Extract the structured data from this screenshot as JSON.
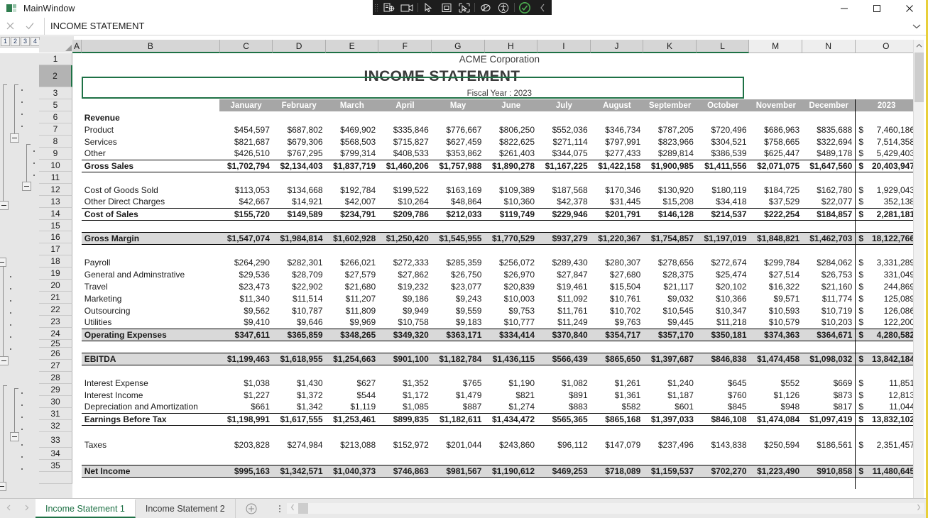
{
  "window": {
    "title": "MainWindow",
    "minimize_label": "Minimize",
    "maximize_label": "Maximize",
    "close_label": "Close"
  },
  "inspector_toolbar": {
    "buttons": [
      "inspect-element-icon",
      "record-video-icon",
      "pointer-select-icon",
      "bounding-box-icon",
      "region-select-icon",
      "highlight-toggle-icon",
      "accessibility-icon",
      "validate-check-icon",
      "collapse-chevron-icon"
    ]
  },
  "formula_bar": {
    "cancel_label": "✕",
    "accept_label": "✓",
    "value": "INCOME STATEMENT",
    "expand_label": "⌄"
  },
  "outline": {
    "levels": [
      "1",
      "2",
      "3",
      "4"
    ]
  },
  "columns": [
    "A",
    "B",
    "C",
    "D",
    "E",
    "F",
    "G",
    "H",
    "I",
    "J",
    "K",
    "L",
    "M",
    "N",
    "O"
  ],
  "rows": [
    "1",
    "2",
    "3",
    "5",
    "6",
    "7",
    "8",
    "9",
    "10",
    "11",
    "12",
    "13",
    "14",
    "15",
    "16",
    "17",
    "18",
    "19",
    "20",
    "21",
    "22",
    "23",
    "24",
    "25",
    "26",
    "27",
    "28",
    "29",
    "30",
    "31",
    "32",
    "33",
    "34",
    "35"
  ],
  "active_row": "2",
  "sheet": {
    "company": "ACME Corporation",
    "title": "INCOME STATEMENT",
    "fiscal_year": "Fiscal Year : 2023",
    "period_headers": [
      "January",
      "February",
      "March",
      "April",
      "May",
      "June",
      "July",
      "August",
      "September",
      "October",
      "November",
      "December",
      "2023"
    ],
    "sections": {
      "revenue_label": "Revenue",
      "gross_sales_label": "Gross Sales",
      "cost_of_sales_label": "Cost of Sales",
      "gross_margin_label": "Gross Margin",
      "operating_expenses_label": "Operating Expenses",
      "ebitda_label": "EBITDA",
      "earnings_before_tax_label": "Earnings Before Tax",
      "net_income_label": "Net Income"
    },
    "rows_data": [
      {
        "row": "6",
        "label": "Revenue",
        "style": "section",
        "values": []
      },
      {
        "row": "7",
        "label": "Product",
        "style": "item",
        "values": [
          "$454,597",
          "$687,802",
          "$469,902",
          "$335,846",
          "$776,667",
          "$806,250",
          "$552,036",
          "$346,734",
          "$787,205",
          "$720,496",
          "$686,963",
          "$835,688"
        ],
        "total": "7,460,186"
      },
      {
        "row": "8",
        "label": "Services",
        "style": "item",
        "values": [
          "$821,687",
          "$679,306",
          "$568,503",
          "$715,827",
          "$627,459",
          "$822,625",
          "$271,114",
          "$797,991",
          "$823,966",
          "$304,521",
          "$758,665",
          "$322,694"
        ],
        "total": "7,514,358"
      },
      {
        "row": "9",
        "label": "Other",
        "style": "item",
        "values": [
          "$426,510",
          "$767,295",
          "$799,314",
          "$408,533",
          "$353,862",
          "$261,403",
          "$344,075",
          "$277,433",
          "$289,814",
          "$386,539",
          "$625,447",
          "$489,178"
        ],
        "total": "5,429,403"
      },
      {
        "row": "10",
        "label": "Gross Sales",
        "style": "subtotal",
        "values": [
          "$1,702,794",
          "$2,134,403",
          "$1,837,719",
          "$1,460,206",
          "$1,757,988",
          "$1,890,278",
          "$1,167,225",
          "$1,422,158",
          "$1,900,985",
          "$1,411,556",
          "$2,071,075",
          "$1,647,560"
        ],
        "total": "20,403,947"
      },
      {
        "row": "11",
        "label": "",
        "style": "blank",
        "values": []
      },
      {
        "row": "12",
        "label": "Cost of Goods Sold",
        "style": "item",
        "values": [
          "$113,053",
          "$134,668",
          "$192,784",
          "$199,522",
          "$163,169",
          "$109,389",
          "$187,568",
          "$170,346",
          "$130,920",
          "$180,119",
          "$184,725",
          "$162,780"
        ],
        "total": "1,929,043"
      },
      {
        "row": "13",
        "label": "Other Direct Charges",
        "style": "item",
        "values": [
          "$42,667",
          "$14,921",
          "$42,007",
          "$10,264",
          "$48,864",
          "$10,360",
          "$42,378",
          "$31,445",
          "$15,208",
          "$34,418",
          "$37,529",
          "$22,077"
        ],
        "total": "352,138"
      },
      {
        "row": "14",
        "label": "Cost of Sales",
        "style": "subtotal",
        "values": [
          "$155,720",
          "$149,589",
          "$234,791",
          "$209,786",
          "$212,033",
          "$119,749",
          "$229,946",
          "$201,791",
          "$146,128",
          "$214,537",
          "$222,254",
          "$184,857"
        ],
        "total": "2,281,181"
      },
      {
        "row": "15",
        "label": "",
        "style": "blank",
        "values": []
      },
      {
        "row": "16",
        "label": "Gross Margin",
        "style": "shaded-total",
        "values": [
          "$1,547,074",
          "$1,984,814",
          "$1,602,928",
          "$1,250,420",
          "$1,545,955",
          "$1,770,529",
          "$937,279",
          "$1,220,367",
          "$1,754,857",
          "$1,197,019",
          "$1,848,821",
          "$1,462,703"
        ],
        "total": "18,122,766"
      },
      {
        "row": "17",
        "label": "",
        "style": "blank",
        "values": []
      },
      {
        "row": "18",
        "label": "Payroll",
        "style": "item",
        "values": [
          "$264,290",
          "$282,301",
          "$266,021",
          "$272,333",
          "$285,359",
          "$256,072",
          "$289,430",
          "$280,307",
          "$278,656",
          "$272,674",
          "$299,784",
          "$284,062"
        ],
        "total": "3,331,289"
      },
      {
        "row": "19",
        "label": "General and Adminstrative",
        "style": "item",
        "values": [
          "$29,536",
          "$28,709",
          "$27,579",
          "$27,862",
          "$26,750",
          "$26,970",
          "$27,847",
          "$27,680",
          "$28,375",
          "$25,474",
          "$27,514",
          "$26,753"
        ],
        "total": "331,049"
      },
      {
        "row": "20",
        "label": "Travel",
        "style": "item",
        "values": [
          "$23,473",
          "$22,902",
          "$21,680",
          "$19,232",
          "$23,077",
          "$20,839",
          "$19,461",
          "$15,504",
          "$21,117",
          "$20,102",
          "$16,322",
          "$21,160"
        ],
        "total": "244,869"
      },
      {
        "row": "21",
        "label": "Marketing",
        "style": "item",
        "values": [
          "$11,340",
          "$11,514",
          "$11,207",
          "$9,186",
          "$9,243",
          "$10,003",
          "$11,092",
          "$10,761",
          "$9,032",
          "$10,366",
          "$9,571",
          "$11,774"
        ],
        "total": "125,089"
      },
      {
        "row": "22",
        "label": "Outsourcing",
        "style": "item",
        "values": [
          "$9,562",
          "$10,787",
          "$11,809",
          "$9,949",
          "$9,559",
          "$9,753",
          "$11,761",
          "$10,702",
          "$10,545",
          "$10,347",
          "$10,593",
          "$10,719"
        ],
        "total": "126,086"
      },
      {
        "row": "23",
        "label": "Utilities",
        "style": "item",
        "values": [
          "$9,410",
          "$9,646",
          "$9,969",
          "$10,758",
          "$9,183",
          "$10,777",
          "$11,249",
          "$9,763",
          "$9,445",
          "$11,218",
          "$10,579",
          "$10,203"
        ],
        "total": "122,200"
      },
      {
        "row": "24",
        "label": "Operating Expenses",
        "style": "shaded-total",
        "values": [
          "$347,611",
          "$365,859",
          "$348,265",
          "$349,320",
          "$363,171",
          "$334,414",
          "$370,840",
          "$354,717",
          "$357,170",
          "$350,181",
          "$374,363",
          "$364,671"
        ],
        "total": "4,280,582"
      },
      {
        "row": "25",
        "label": "",
        "style": "blank",
        "values": []
      },
      {
        "row": "26",
        "label": "EBITDA",
        "style": "shaded-total",
        "values": [
          "$1,199,463",
          "$1,618,955",
          "$1,254,663",
          "$901,100",
          "$1,182,784",
          "$1,436,115",
          "$566,439",
          "$865,650",
          "$1,397,687",
          "$846,838",
          "$1,474,458",
          "$1,098,032"
        ],
        "total": "13,842,184"
      },
      {
        "row": "27",
        "label": "",
        "style": "blank",
        "values": []
      },
      {
        "row": "28",
        "label": "Interest Expense",
        "style": "item",
        "values": [
          "$1,038",
          "$1,430",
          "$627",
          "$1,352",
          "$765",
          "$1,190",
          "$1,082",
          "$1,261",
          "$1,240",
          "$645",
          "$552",
          "$669"
        ],
        "total": "11,851"
      },
      {
        "row": "29",
        "label": "Interest Income",
        "style": "item",
        "values": [
          "$1,227",
          "$1,372",
          "$544",
          "$1,172",
          "$1,479",
          "$821",
          "$891",
          "$1,361",
          "$1,187",
          "$760",
          "$1,126",
          "$873"
        ],
        "total": "12,813"
      },
      {
        "row": "30",
        "label": "Depreciation and Amortization",
        "style": "item",
        "values": [
          "$661",
          "$1,342",
          "$1,119",
          "$1,085",
          "$887",
          "$1,274",
          "$883",
          "$582",
          "$601",
          "$845",
          "$948",
          "$817"
        ],
        "total": "11,044"
      },
      {
        "row": "31",
        "label": "Earnings Before Tax",
        "style": "subtotal",
        "values": [
          "$1,198,991",
          "$1,617,555",
          "$1,253,461",
          "$899,835",
          "$1,182,611",
          "$1,434,472",
          "$565,365",
          "$865,168",
          "$1,397,033",
          "$846,108",
          "$1,474,084",
          "$1,097,419"
        ],
        "total": "13,832,102"
      },
      {
        "row": "32",
        "label": "",
        "style": "blank",
        "values": []
      },
      {
        "row": "33",
        "label": "Taxes",
        "style": "item",
        "values": [
          "$203,828",
          "$274,984",
          "$213,088",
          "$152,972",
          "$201,044",
          "$243,860",
          "$96,112",
          "$147,079",
          "$237,496",
          "$143,838",
          "$250,594",
          "$186,561"
        ],
        "total": "2,351,457"
      },
      {
        "row": "34",
        "label": "",
        "style": "blank",
        "values": []
      },
      {
        "row": "35",
        "label": "Net Income",
        "style": "shaded-total",
        "values": [
          "$995,163",
          "$1,342,571",
          "$1,040,373",
          "$746,863",
          "$981,567",
          "$1,190,612",
          "$469,253",
          "$718,089",
          "$1,159,537",
          "$702,270",
          "$1,223,490",
          "$910,858"
        ],
        "total": "11,480,645"
      }
    ],
    "currency_symbol": "$"
  },
  "tabs": {
    "prev_label": "◀",
    "next_label": "▶",
    "items": [
      {
        "label": "Income Statement 1",
        "active": true
      },
      {
        "label": "Income Statement 2",
        "active": false
      }
    ],
    "add_label": "+"
  },
  "scrollbars": {
    "v_up": "⌃",
    "v_down": "⌄",
    "h_left": "‹",
    "h_right": "›"
  },
  "colors": {
    "accent_green": "#1e7145",
    "header_gray": "#a6a6a6",
    "shade_gray": "#d9d9d9",
    "colheader_gray": "#d6d6d6",
    "window_yellow": "#e8cf3a"
  }
}
